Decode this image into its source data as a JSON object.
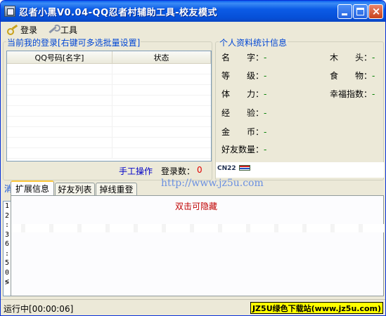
{
  "window": {
    "title": "忍者小黑V0.04-QQ忍者村辅助工具-校友模式",
    "close_glyph": "×"
  },
  "menu": {
    "login": "登录",
    "tools": "工具"
  },
  "login_panel": {
    "title": "当前我的登录[右键可多选批量设置]",
    "columns": [
      "QQ号码[名字]",
      "状态"
    ],
    "manual_link": "手工操作",
    "login_count_label": "登录数：",
    "login_count_value": "0"
  },
  "profile": {
    "title": "个人资料统计信息",
    "stats": [
      {
        "label": "名　　字：",
        "value": "-"
      },
      {
        "label": "等　　级：",
        "value": "-"
      },
      {
        "label": "体　　力：",
        "value": "-"
      },
      {
        "label": "经　　验：",
        "value": "-"
      },
      {
        "label": "金　　币：",
        "value": "-"
      },
      {
        "label": "好友数量：",
        "value": "-"
      },
      {
        "label": "木　　头：",
        "value": "-"
      },
      {
        "label": "食　　物：",
        "value": "-"
      },
      {
        "label": "幸福指数：",
        "value": "-"
      }
    ],
    "badge_text": "CN22"
  },
  "tabs": {
    "group_title": "消",
    "items": [
      "扩展信息",
      "好友列表",
      "掉线重登"
    ],
    "active_index": 0,
    "hide_hint": "双击可隐藏"
  },
  "watermark_url": "http://www.jz5u.com",
  "log_gutter": [
    "1",
    "2",
    ":",
    "3",
    "6",
    ":",
    "5",
    "0",
    "≶"
  ],
  "status": {
    "text": "运行中[00:00:06]",
    "brand": "JZ5U绿色下载站(www.jz5u.com)"
  },
  "colors": {
    "titlebar": "#0a5ff0",
    "group_title": "#0046d5",
    "link": "#0000c8",
    "count": "#e00000",
    "stat_value": "#008000",
    "brand_bg": "#ffff00"
  }
}
